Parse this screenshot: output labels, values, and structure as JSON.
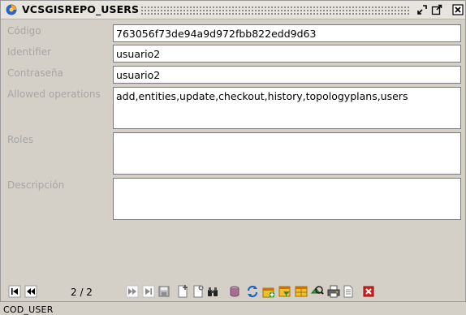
{
  "window": {
    "title": "VCSGISREPO_USERS"
  },
  "form": {
    "codigo": {
      "label": "Código",
      "value": "763056f73de94a9d972fbb822edd9d63"
    },
    "identifier": {
      "label": "Identifier",
      "value": "usuario2"
    },
    "contrasena": {
      "label": "Contraseña",
      "value": "usuario2"
    },
    "allowed_operations": {
      "label": "Allowed operations",
      "value": "add,entities,update,checkout,history,topologyplans,users"
    },
    "roles": {
      "label": "Roles",
      "value": ""
    },
    "descripcion": {
      "label": "Descripción",
      "value": ""
    }
  },
  "navigation": {
    "pager": "2 / 2"
  },
  "status": {
    "text": "COD_USER"
  }
}
